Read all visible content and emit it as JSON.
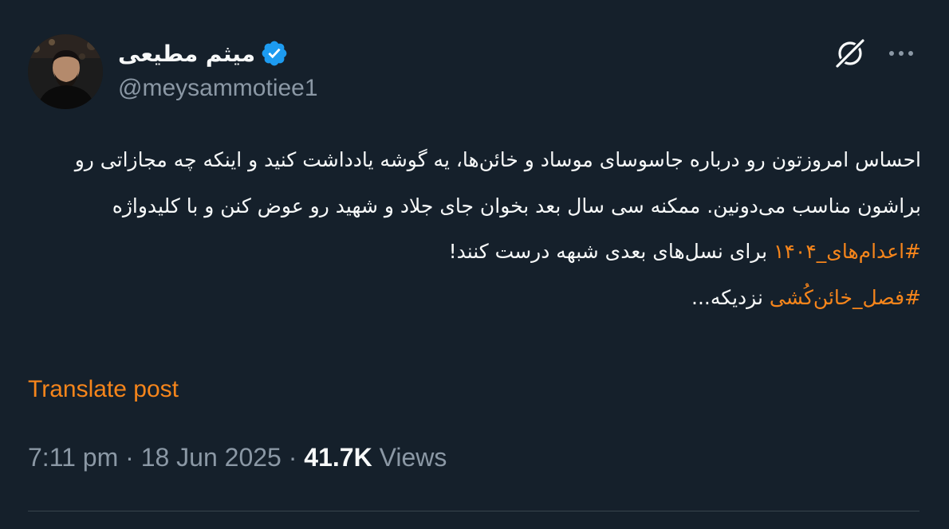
{
  "author": {
    "display_name": "میثم مطیعی",
    "handle": "@meysammotiee1",
    "verified": true,
    "verified_color": "#1d9bf0"
  },
  "icons": {
    "verified": "verified-badge-icon",
    "grok": "grok-icon",
    "more": "more-options-icon"
  },
  "tweet": {
    "line1": "احساس امروزتون رو درباره جاسوسای موساد و خائن‌ها، یه گوشه یادداشت کنید و اینکه چه مجازاتی رو براشون مناسب می‌دونین. ممکنه سی سال بعد بخوان جای جلاد و شهید رو عوض کنن و با کلیدواژه ",
    "hashtag1": "#اعدام‌های_۱۴۰۴",
    "line1_end": " برای نسل‌های بعدی شبهه درست کنند!",
    "hashtag2": "#فصل_خائن‌کُشی",
    "line2_end": " نزدیکه..."
  },
  "translate_label": "Translate post",
  "meta": {
    "time": "7:11 pm",
    "separator": " · ",
    "date": "18 Jun 2025",
    "views_count": "41.7K",
    "views_label": "Views"
  },
  "colors": {
    "background": "#15202b",
    "accent": "#f6851b",
    "text": "#f7f9f9",
    "secondary": "#8b98a5",
    "divider": "#38444d"
  }
}
